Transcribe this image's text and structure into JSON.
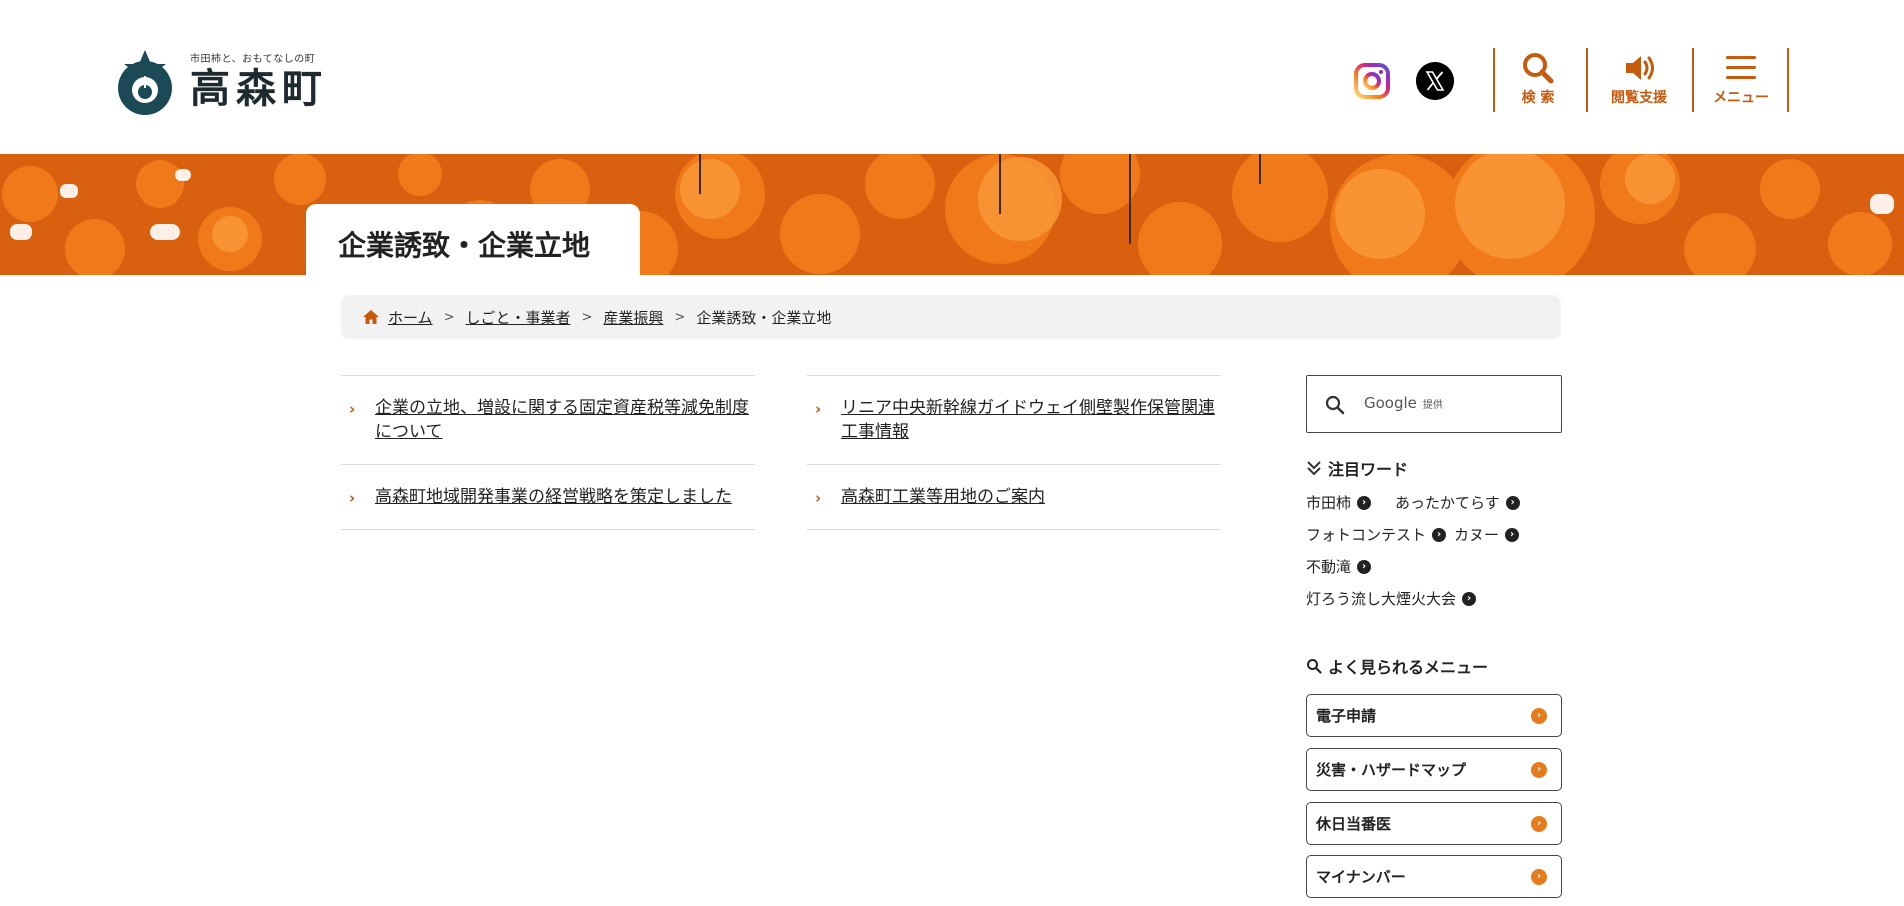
{
  "header": {
    "logo_tagline": "市田柿と、おもてなしの町",
    "logo_name": "高森町",
    "buttons": {
      "search": "検 索",
      "accessibility": "閲覧支援",
      "menu": "メニュー"
    },
    "icons": [
      "instagram-icon",
      "x-icon",
      "search-icon",
      "speaker-icon",
      "hamburger-icon"
    ],
    "accent_color": "#c65b0e"
  },
  "page": {
    "title": "企業誘致・企業立地"
  },
  "breadcrumb": {
    "items": [
      "ホーム",
      "しごと・事業者",
      "産業振興"
    ],
    "current": "企業誘致・企業立地"
  },
  "links": {
    "left": [
      "企業の立地、増設に関する固定資産税等減免制度について",
      "高森町地域開発事業の経営戦略を策定しました"
    ],
    "right": [
      "リニア中央新幹線ガイドウェイ側壁製作保管関連工事情報",
      "高森町工業等用地のご案内"
    ]
  },
  "sidebar": {
    "search": {
      "text": "Google",
      "provided": "提供"
    },
    "keywords_heading": "注目ワード",
    "keywords": [
      "市田柿",
      "あったかてらす",
      "フォトコンテスト",
      "カヌー",
      "不動滝",
      "灯ろう流し大煙火大会"
    ],
    "popular_heading": "よく見られるメニュー",
    "popular_menu": [
      "電子申請",
      "災害・ハザードマップ",
      "休日当番医",
      "マイナンバー"
    ]
  }
}
